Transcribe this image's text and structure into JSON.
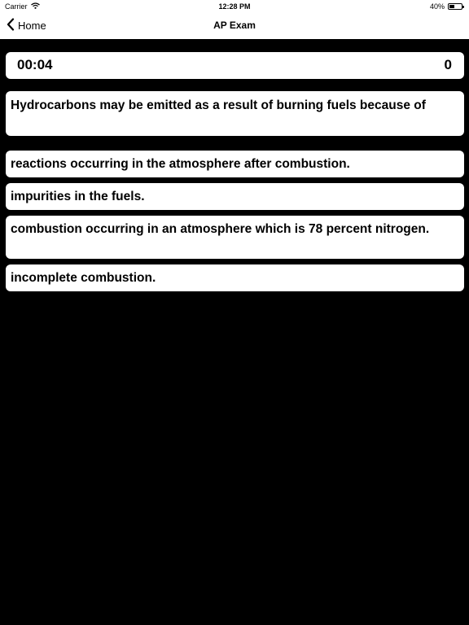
{
  "status_bar": {
    "carrier": "Carrier",
    "time": "12:28 PM",
    "battery_text": "40%",
    "battery_level": 0.4
  },
  "nav": {
    "back_label": "Home",
    "title": "AP Exam"
  },
  "quiz": {
    "timer": "00:04",
    "score": "0",
    "question": "Hydrocarbons may be emitted as a result of burning fuels because of",
    "answers": [
      "reactions occurring in the atmosphere after combustion.",
      "impurities in the fuels.",
      "combustion occurring in an atmosphere which is 78 percent nitrogen.",
      "incomplete combustion."
    ]
  }
}
